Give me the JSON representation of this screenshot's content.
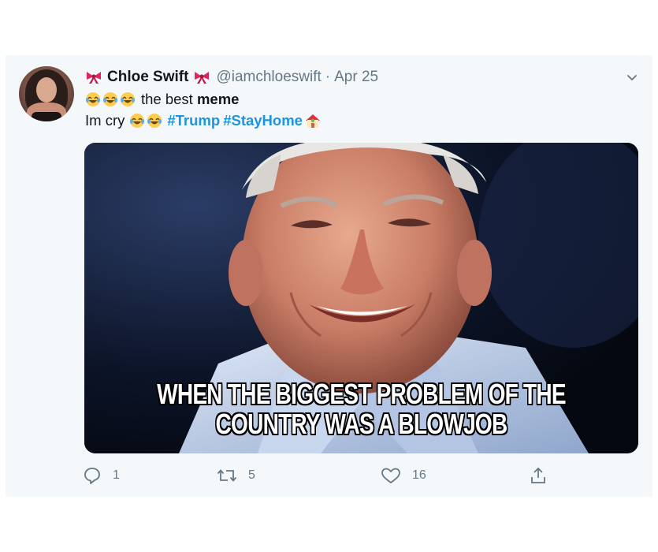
{
  "tweet": {
    "author": {
      "display_name": "Chloe Swift",
      "handle": "@iamchloeswift",
      "separator": "·",
      "date": "Apr 25"
    },
    "text": {
      "line1_prefix": "the best ",
      "line1_bold": "meme",
      "line2_prefix": "Im cry",
      "hashtag1": "#Trump",
      "hashtag2": "#StayHome"
    },
    "media": {
      "caption_line1": "WHEN THE BIGGEST PROBLEM OF THE",
      "caption_line2": "COUNTRY WAS A BLOWJOB"
    },
    "actions": {
      "reply_count": "1",
      "retweet_count": "5",
      "like_count": "16"
    },
    "icons": [
      "ribbon-icon",
      "laughing-emoji-icon",
      "house-emoji-icon",
      "chevron-down-icon",
      "reply-icon",
      "retweet-icon",
      "like-icon",
      "share-icon"
    ],
    "colors": {
      "background": "#f5f8fa",
      "hashtag": "#1b95e0",
      "muted": "#657786",
      "text": "#14171a",
      "ribbon": "#e0245e"
    }
  }
}
